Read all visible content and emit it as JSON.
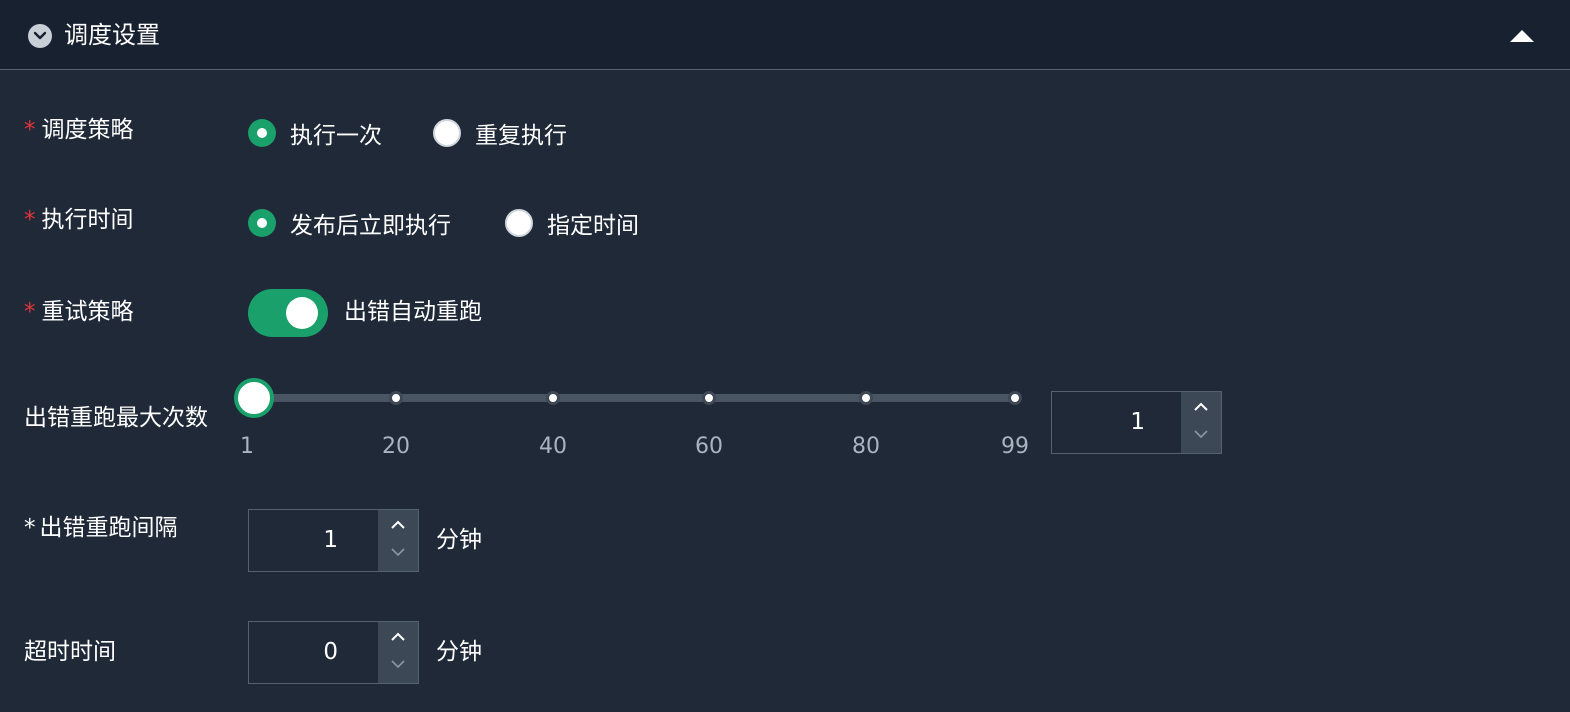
{
  "header": {
    "title": "调度设置",
    "icon": "clock-icon",
    "collapse_icon": "caret-up-icon"
  },
  "schedule_strategy": {
    "required_mark": "*",
    "label": "调度策略",
    "options": [
      {
        "label": "执行一次",
        "selected": true
      },
      {
        "label": "重复执行",
        "selected": false
      }
    ]
  },
  "execution_time": {
    "required_mark": "*",
    "label": "执行时间",
    "options": [
      {
        "label": "发布后立即执行",
        "selected": true
      },
      {
        "label": "指定时间",
        "selected": false
      }
    ]
  },
  "retry_strategy": {
    "required_mark": "*",
    "label": "重试策略",
    "enabled": true,
    "switch_text": "出错自动重跑"
  },
  "max_retries": {
    "label": "出错重跑最大次数",
    "min": 1,
    "max": 99,
    "value": 1,
    "value_text": "1",
    "ticks": [
      "1",
      "20",
      "40",
      "60",
      "80",
      "99"
    ]
  },
  "retry_interval": {
    "required_mark": "*",
    "label": "出错重跑间隔",
    "value": "1",
    "unit": "分钟"
  },
  "timeout": {
    "label": "超时时间",
    "value": "0",
    "unit": "分钟"
  },
  "colors": {
    "accent": "#1aa06b",
    "required": "#e0353b",
    "background": "#1f2937",
    "header_background": "#18212f"
  }
}
